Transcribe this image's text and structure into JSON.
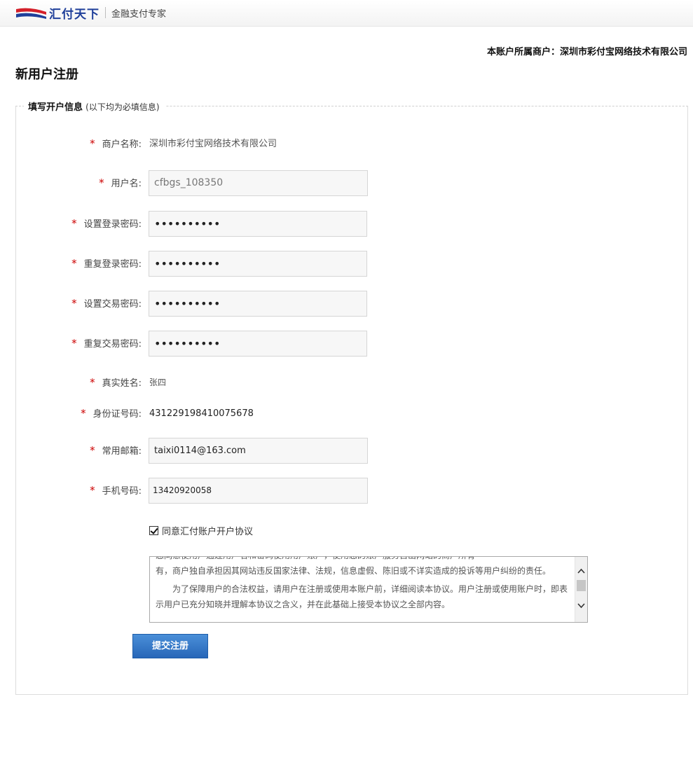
{
  "header": {
    "brand_name": "汇付天下",
    "brand_small": "chinapnr",
    "slogan": "金融支付专家"
  },
  "merchant_line": "本账户所属商户：深圳市彩付宝网络技术有限公司",
  "page_title": "新用户注册",
  "section": {
    "legend_title": "填写开户信息",
    "legend_note": "(以下均为必填信息)"
  },
  "form": {
    "required_mark": "*",
    "merchant_name": {
      "label": "商户名称:",
      "value": "深圳市彩付宝网络技术有限公司"
    },
    "username": {
      "label": "用户名:",
      "value": "cfbgs_108350"
    },
    "login_password": {
      "label": "设置登录密码:",
      "value": "••••••••••"
    },
    "login_password_repeat": {
      "label": "重复登录密码:",
      "value": "••••••••••"
    },
    "trade_password": {
      "label": "设置交易密码:",
      "value": "••••••••••"
    },
    "trade_password_repeat": {
      "label": "重复交易密码:",
      "value": "••••••••••"
    },
    "real_name": {
      "label": "真实姓名:",
      "value": "张四"
    },
    "id_number": {
      "label": "身份证号码:",
      "value": "431229198410075678"
    },
    "email": {
      "label": "常用邮箱:",
      "value": "taixi0114@163.com"
    },
    "phone": {
      "label": "手机号码:",
      "value": "13420920058"
    }
  },
  "agreement": {
    "checked": true,
    "label": "同意汇付账户开户协议",
    "text_cut": "您同意使用户通过用户名和密码使用用户账户，使用您的账户服务自出网站的商户所有",
    "text_line1": "有，商户独自承担因其网站违反国家法律、法规，信息虚假、陈旧或不详实造成的投诉等用户纠纷的责任。",
    "text_line2": "　　为了保障用户的合法权益，请用户在注册或使用本账户前，详细阅读本协议。用户注册或使用账户时，即表",
    "text_line3": "示用户已充分知晓并理解本协议之含义，并在此基础上接受本协议之全部内容。"
  },
  "submit_label": "提交注册"
}
